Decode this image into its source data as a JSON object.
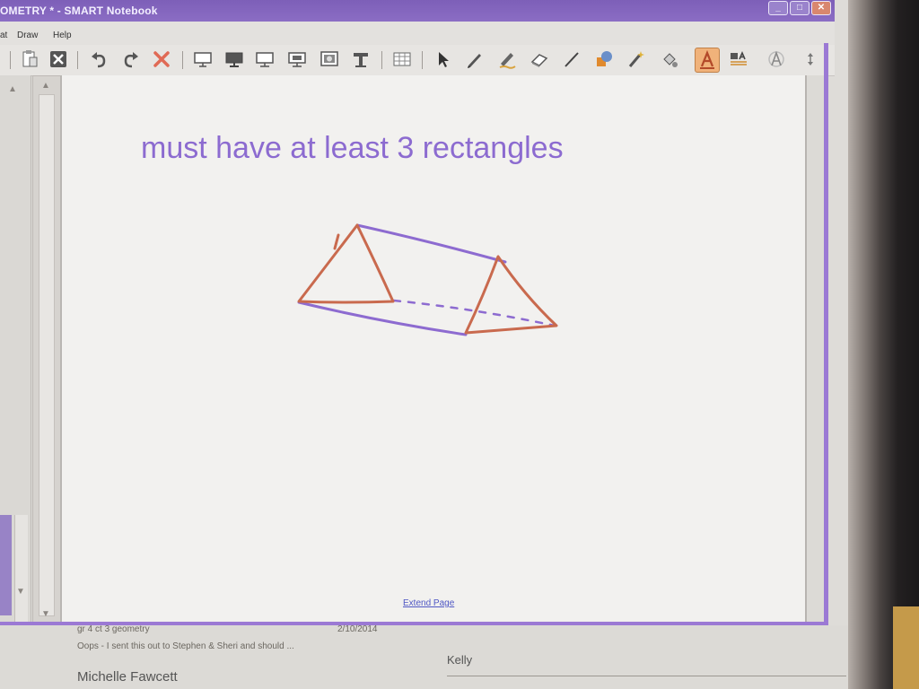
{
  "window": {
    "title": "OMETRY * - SMART Notebook"
  },
  "menu": {
    "items": [
      "at",
      "Draw",
      "Help"
    ]
  },
  "toolbar": {
    "buttons": [
      "clipboard-icon",
      "delete-page-icon",
      "undo-icon",
      "redo-icon",
      "delete-icon",
      "screen-shade-icon",
      "display-icon",
      "monitor-icon",
      "full-screen-icon",
      "capture-icon",
      "document-camera-icon",
      "table-icon",
      "select-icon",
      "pen-icon",
      "creative-pen-icon",
      "eraser-icon",
      "line-icon",
      "shapes-icon",
      "magic-pen-icon",
      "fill-icon",
      "text-icon",
      "text-style-icon",
      "properties-icon",
      "more-icon"
    ],
    "active": "text-icon"
  },
  "page": {
    "heading": "must have at least 3 rectangles",
    "extend_link": "Extend Page"
  },
  "colors": {
    "accent_purple": "#9b79d4",
    "ink_red": "#c96a4e",
    "ink_purple": "#8d6bd0"
  },
  "lower": {
    "subject": "gr 4 ct 3 geometry",
    "date": "2/10/2014",
    "preview": "Oops - I sent this out to Stephen & Sheri and should ...",
    "sender": "Michelle Fawcett",
    "recipient": "Kelly"
  }
}
